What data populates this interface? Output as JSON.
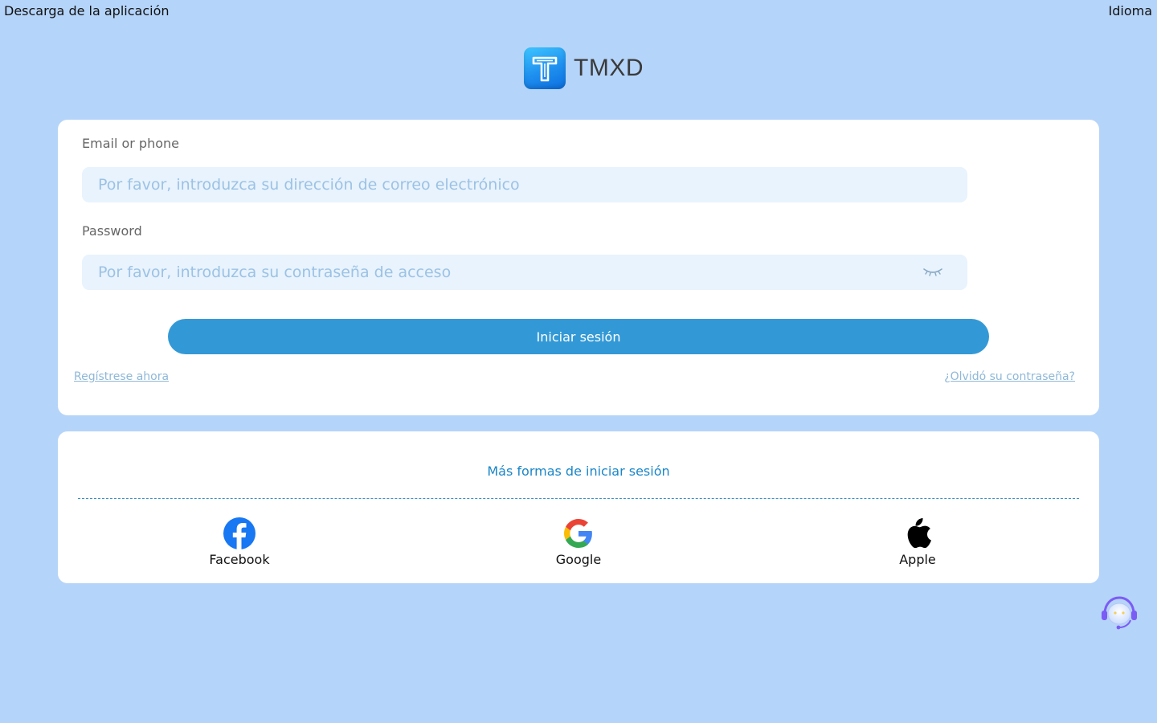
{
  "topbar": {
    "download_label": "Descarga de la aplicación",
    "language_label": "Idioma"
  },
  "brand": {
    "name": "TMXD",
    "accent": "#1e8fef"
  },
  "login": {
    "email_label": "Email or phone",
    "email_placeholder": "Por favor, introduzca su dirección de correo electrónico",
    "password_label": "Password",
    "password_placeholder": "Por favor, introduzca su contraseña de acceso",
    "submit_label": "Iniciar sesión",
    "register_link": "Regístrese ahora",
    "forgot_link": "¿Olvidó su contraseña?"
  },
  "social": {
    "title": "Más formas de iniciar sesión",
    "providers": [
      {
        "label": "Facebook",
        "icon": "facebook-icon"
      },
      {
        "label": "Google",
        "icon": "google-icon"
      },
      {
        "label": "Apple",
        "icon": "apple-icon"
      }
    ]
  },
  "support": {
    "icon": "customer-support-icon"
  },
  "colors": {
    "background": "#b5d4f9",
    "button": "#3399d6",
    "input_bg": "#e8f3fd"
  }
}
